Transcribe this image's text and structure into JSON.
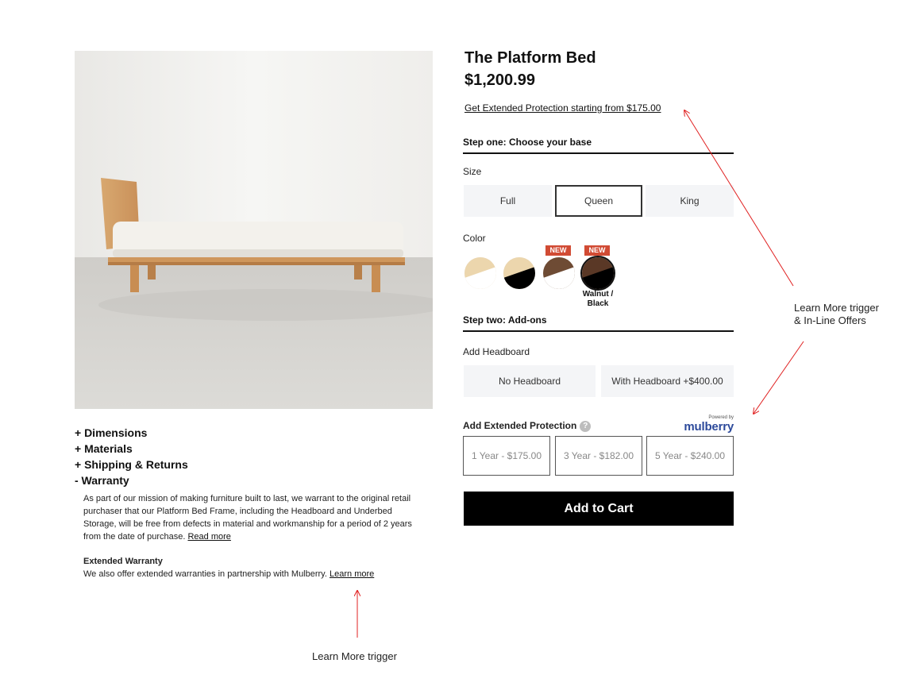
{
  "product": {
    "title": "The Platform Bed",
    "price": "$1,200.99",
    "protection_link": "Get Extended Protection starting from $175.00",
    "image": "platform-bed-photo"
  },
  "step_one": {
    "title": "Step one: Choose your base",
    "size_label": "Size",
    "sizes": [
      "Full",
      "Queen",
      "King"
    ],
    "selected_size": "Queen",
    "color_label": "Color",
    "color_swatches": [
      {
        "top": "#ecd6ad",
        "bottom": "#ffffff",
        "badge": ""
      },
      {
        "top": "#ecd6ad",
        "bottom": "#000000",
        "badge": ""
      },
      {
        "top": "#6e4b34",
        "bottom": "#ffffff",
        "badge": "NEW"
      },
      {
        "top": "#5a3826",
        "bottom": "#000000",
        "badge": "NEW"
      }
    ],
    "selected_color_name": "Walnut / Black"
  },
  "step_two": {
    "title": "Step two: Add-ons",
    "headboard_label": "Add Headboard",
    "headboard_options": [
      "No Headboard",
      "With Headboard +$400.00"
    ]
  },
  "protection": {
    "label": "Add Extended Protection",
    "help_icon": "question-mark-icon",
    "powered_by": "Powered by",
    "brand": "mulberry",
    "plans": [
      "1 Year - $175.00",
      "3 Year - $182.00",
      "5 Year - $240.00"
    ]
  },
  "add_to_cart": "Add to Cart",
  "accordion": {
    "items": [
      "+ Dimensions",
      "+ Materials",
      "+ Shipping & Returns",
      "- Warranty"
    ],
    "warranty_text": "As part of our mission of making furniture built to last, we warrant to the original retail purchaser that our Platform Bed Frame, including the Headboard and Underbed Storage, will be free from defects in material and workmanship for a period of 2 years from the date of purchase.",
    "read_more": "Read more",
    "extended_title": "Extended Warranty",
    "extended_text": "We also offer extended warranties in partnership with Mulberry.",
    "learn_more": "Learn more"
  },
  "annotations": {
    "right_line1": "Learn More trigger",
    "right_line2": "& In-Line Offers",
    "bottom": "Learn More trigger"
  },
  "colors": {
    "badge": "#d14b34",
    "brand": "#2d4a9b",
    "arrow": "#e02020",
    "option_bg": "#f4f5f7"
  }
}
